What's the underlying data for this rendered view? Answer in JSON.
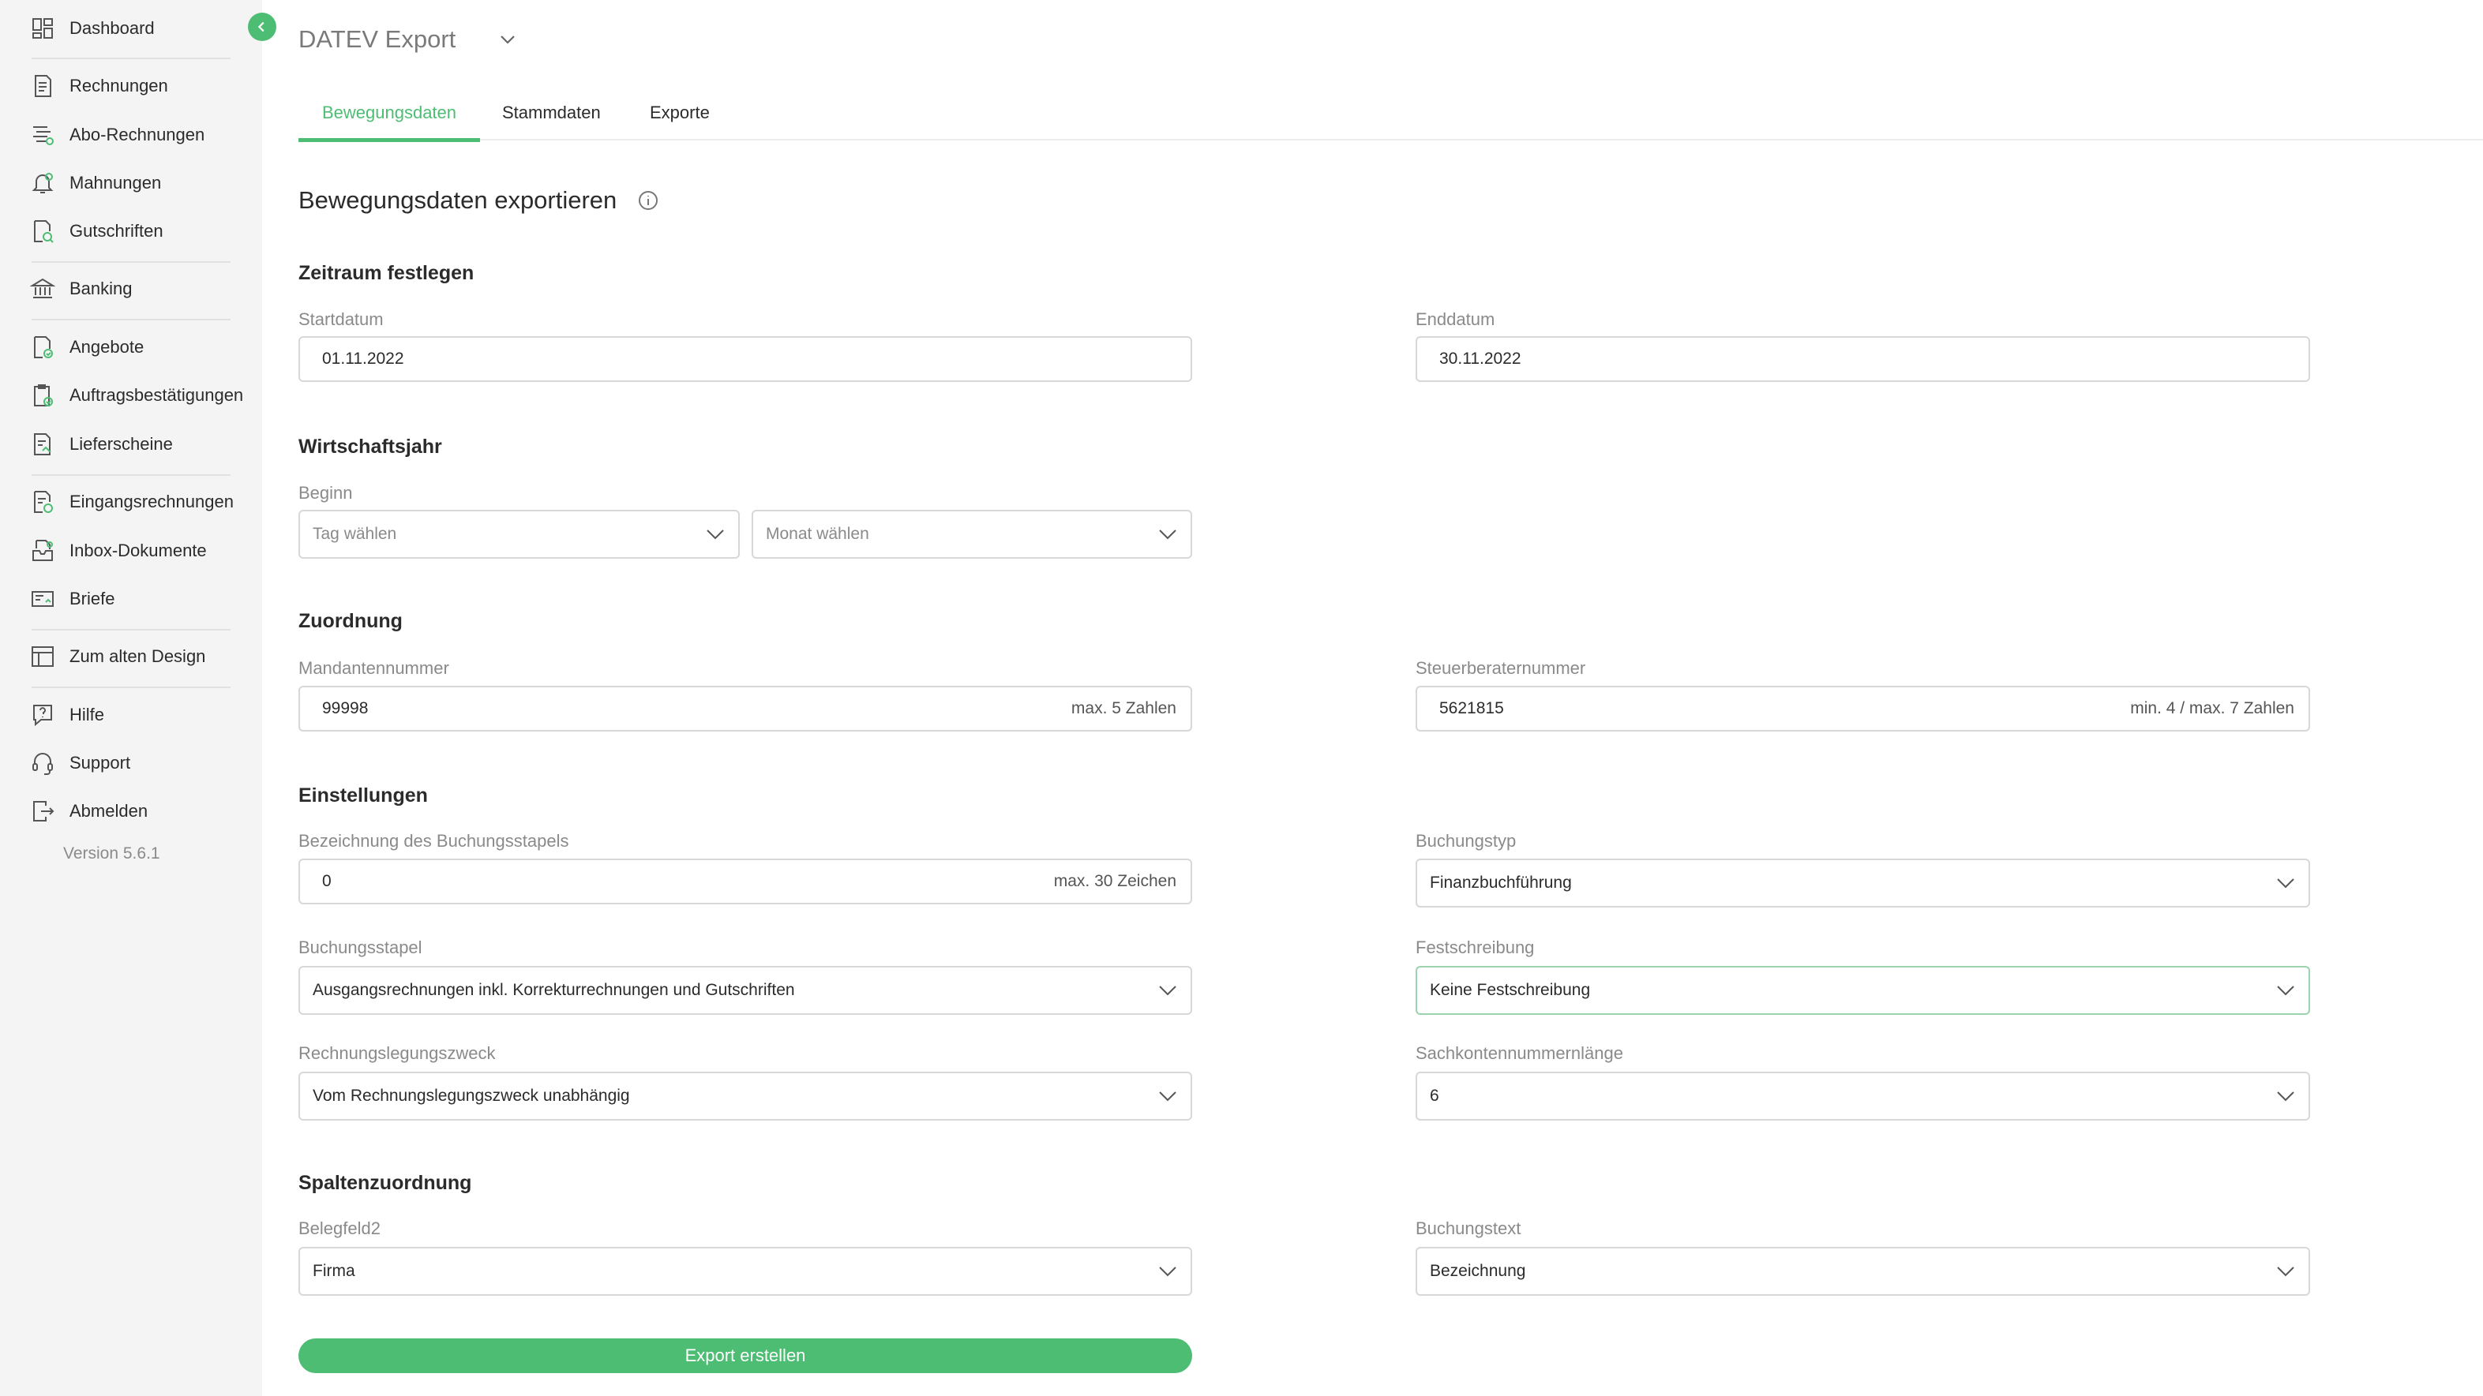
{
  "sidebar": {
    "items": [
      {
        "label": "Dashboard",
        "icon": "dashboard-icon"
      },
      {
        "label": "Rechnungen",
        "icon": "invoice-icon"
      },
      {
        "label": "Abo-Rechnungen",
        "icon": "subscription-invoice-icon"
      },
      {
        "label": "Mahnungen",
        "icon": "reminder-icon"
      },
      {
        "label": "Gutschriften",
        "icon": "credit-note-icon"
      },
      {
        "label": "Banking",
        "icon": "bank-icon"
      },
      {
        "label": "Angebote",
        "icon": "offer-icon"
      },
      {
        "label": "Auftragsbestätigungen",
        "icon": "order-confirmation-icon"
      },
      {
        "label": "Lieferscheine",
        "icon": "delivery-note-icon"
      },
      {
        "label": "Eingangsrechnungen",
        "icon": "incoming-invoice-icon"
      },
      {
        "label": "Inbox-Dokumente",
        "icon": "inbox-icon"
      },
      {
        "label": "Briefe",
        "icon": "letter-icon"
      },
      {
        "label": "Zum alten Design",
        "icon": "layout-icon"
      },
      {
        "label": "Hilfe",
        "icon": "help-icon"
      },
      {
        "label": "Support",
        "icon": "headset-icon"
      },
      {
        "label": "Abmelden",
        "icon": "logout-icon"
      }
    ],
    "version": "Version 5.6.1"
  },
  "header": {
    "title": "DATEV Export"
  },
  "tabs": [
    {
      "label": "Bewegungsdaten",
      "active": true
    },
    {
      "label": "Stammdaten",
      "active": false
    },
    {
      "label": "Exporte",
      "active": false
    }
  ],
  "page": {
    "heading": "Bewegungsdaten exportieren"
  },
  "zeitraum": {
    "title": "Zeitraum festlegen",
    "start_label": "Startdatum",
    "start_value": "01.11.2022",
    "end_label": "Enddatum",
    "end_value": "30.11.2022"
  },
  "wirtschaftsjahr": {
    "title": "Wirtschaftsjahr",
    "begin_label": "Beginn",
    "day_placeholder": "Tag wählen",
    "month_placeholder": "Monat wählen"
  },
  "zuordnung": {
    "title": "Zuordnung",
    "mandant_label": "Mandantennummer",
    "mandant_value": "99998",
    "mandant_hint": "max. 5 Zahlen",
    "berater_label": "Steuerberaternummer",
    "berater_value": "5621815",
    "berater_hint": "min. 4 / max. 7 Zahlen"
  },
  "einstellungen": {
    "title": "Einstellungen",
    "stapel_name_label": "Bezeichnung des Buchungsstapels",
    "stapel_name_value": "0",
    "stapel_name_hint": "max. 30 Zeichen",
    "buchungstyp_label": "Buchungstyp",
    "buchungstyp_value": "Finanzbuchführung",
    "stapel_label": "Buchungsstapel",
    "stapel_value": "Ausgangsrechnungen inkl. Korrekturrechnungen und Gutschriften",
    "fest_label": "Festschreibung",
    "fest_value": "Keine Festschreibung",
    "zweck_label": "Rechnungslegungszweck",
    "zweck_value": "Vom Rechnungslegungszweck unabhängig",
    "sachkonto_label": "Sachkontennummernlänge",
    "sachkonto_value": "6"
  },
  "spalten": {
    "title": "Spaltenzuordnung",
    "belegfeld_label": "Belegfeld2",
    "belegfeld_value": "Firma",
    "buchungstext_label": "Buchungstext",
    "buchungstext_value": "Bezeichnung"
  },
  "actions": {
    "export_label": "Export erstellen"
  },
  "colors": {
    "accent": "#4dbd74",
    "sidebar_bg": "#f4f4f4",
    "border": "#d7d7d7",
    "muted": "#8a8a8a"
  }
}
